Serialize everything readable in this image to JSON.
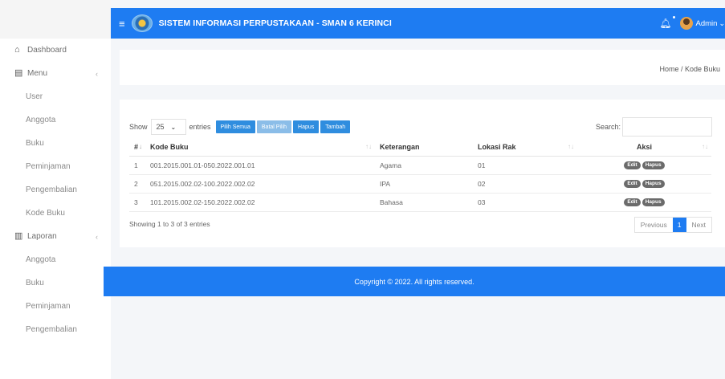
{
  "header": {
    "title": "SISTEM INFORMASI PERPUSTAKAAN - SMAN 6 KERINCI",
    "user": "Admin"
  },
  "sidebar": {
    "dashboard": "Dashboard",
    "menu": {
      "label": "Menu",
      "items": [
        "User",
        "Anggota",
        "Buku",
        "Peminjaman",
        "Pengembalian",
        "Kode Buku"
      ]
    },
    "laporan": {
      "label": "Laporan",
      "items": [
        "Anggota",
        "Buku",
        "Peminjaman",
        "Pengembalian"
      ]
    }
  },
  "breadcrumb": "Home / Kode Buku",
  "toolbar": {
    "show_label": "Show",
    "entries_value": "25",
    "entries_label": "entries",
    "pilih_semua": "Pilih Semua",
    "batal_pilih": "Batal Pilih",
    "hapus": "Hapus",
    "tambah": "Tambah",
    "search_label": "Search:"
  },
  "table": {
    "columns": [
      "#",
      "Kode Buku",
      "Keterangan",
      "Lokasi Rak",
      "Aksi"
    ],
    "rows": [
      {
        "no": "1",
        "kode": "001.2015.001.01-050.2022.001.01",
        "keterangan": "Agama",
        "rak": "01"
      },
      {
        "no": "2",
        "kode": "051.2015.002.02-100.2022.002.02",
        "keterangan": "IPA",
        "rak": "02"
      },
      {
        "no": "3",
        "kode": "101.2015.002.02-150.2022.002.02",
        "keterangan": "Bahasa",
        "rak": "03"
      }
    ],
    "edit_label": "Edit",
    "hapus_label": "Hapus"
  },
  "info": "Showing 1 to 3 of 3 entries",
  "pagination": {
    "previous": "Previous",
    "current": "1",
    "next": "Next"
  },
  "footer": "Copyright © 2022. All rights reserved.",
  "colors": {
    "primary": "#1e7cf2",
    "button": "#2f8ddf",
    "button_disabled": "#8bbde8"
  }
}
